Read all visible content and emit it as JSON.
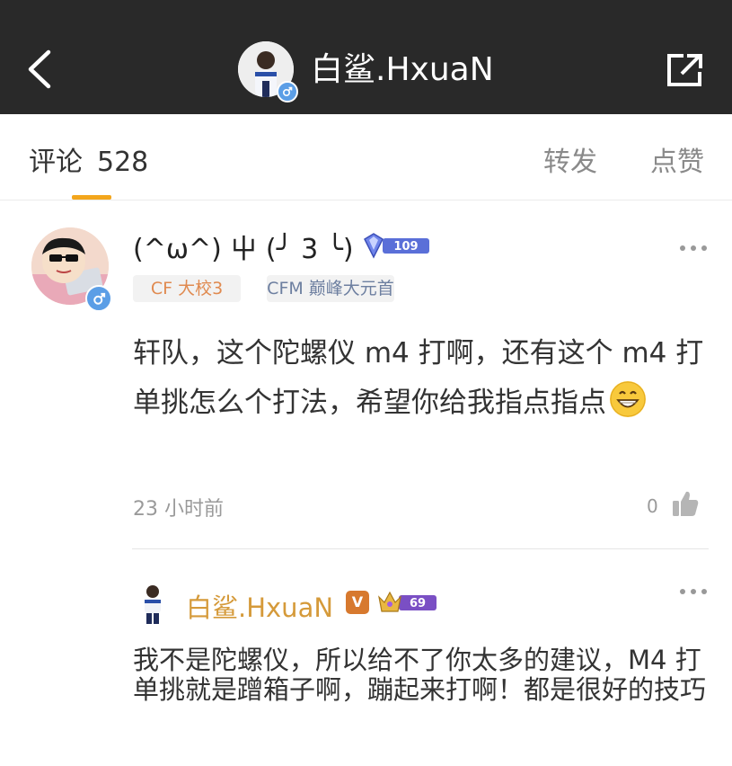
{
  "header": {
    "title": "白鲨.HxuaN",
    "back_icon": "chevron-left-icon",
    "share_icon": "share-external-icon"
  },
  "tabs": {
    "comments_label": "评论",
    "comments_count": "528",
    "repost_label": "转发",
    "like_label": "点赞",
    "active_accent": "#f3a61c"
  },
  "comment": {
    "username": "(^ω^) 屮 (╯ 3 ╰)",
    "level": "109",
    "tags": [
      "CF 大校3",
      "CFM 巅峰大元首"
    ],
    "text": "轩队，这个陀螺仪 m4 打啊，还有这个 m4 打单挑怎么个打法，希望你给我指点指点",
    "emoji": "grinning-face-emoji",
    "time": "23 小时前",
    "likes": "0"
  },
  "reply": {
    "username": "白鲨.HxuaN",
    "verified_badge": "V",
    "level": "69",
    "text": "我不是陀螺仪，所以给不了你太多的建议，M4 打单挑就是蹭箱子啊，蹦起来打啊！都是很好的技巧"
  }
}
